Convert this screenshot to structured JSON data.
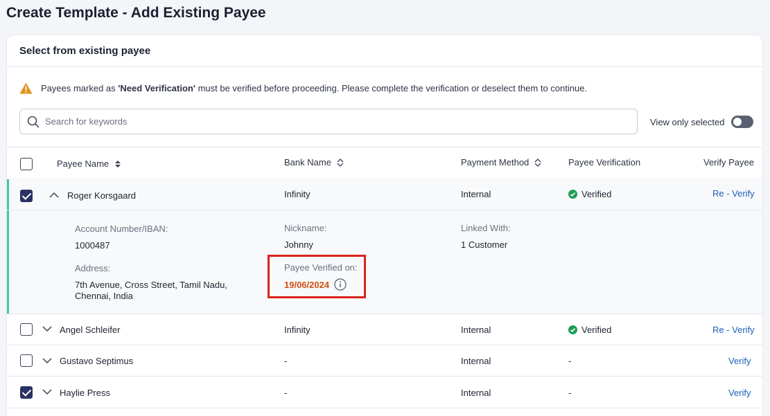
{
  "page": {
    "title": "Create Template - Add Existing Payee"
  },
  "card": {
    "title": "Select from existing payee"
  },
  "warning": {
    "prefix": "Payees marked as ",
    "highlight": "'Need Verification'",
    "suffix": " must be verified before proceeding. Please complete the verification or deselect them to continue."
  },
  "search": {
    "placeholder": "Search for keywords"
  },
  "toggle": {
    "label": "View only selected",
    "on": false
  },
  "table": {
    "headers": {
      "payee_name": "Payee Name",
      "bank_name": "Bank Name",
      "payment_method": "Payment Method",
      "payee_verification": "Payee Verification",
      "verify_payee": "Verify Payee"
    },
    "rows": [
      {
        "name": "Roger Korsgaard",
        "bank": "Infinity",
        "method": "Internal",
        "verification": "Verified",
        "action": "Re - Verify",
        "checked": true,
        "expanded": true
      },
      {
        "name": "Angel Schleifer",
        "bank": "Infinity",
        "method": "Internal",
        "verification": "Verified",
        "action": "Re - Verify",
        "checked": false,
        "expanded": false
      },
      {
        "name": "Gustavo Septimus",
        "bank": "-",
        "method": "Internal",
        "verification": "-",
        "action": "Verify",
        "checked": false,
        "expanded": false
      },
      {
        "name": "Haylie Press",
        "bank": "-",
        "method": "Internal",
        "verification": "-",
        "action": "Verify",
        "checked": true,
        "expanded": false
      }
    ]
  },
  "details": {
    "account_label": "Account Number/IBAN:",
    "account_value": "1000487",
    "nickname_label": "Nickname:",
    "nickname_value": "Johnny",
    "linked_label": "Linked With:",
    "linked_value": "1 Customer",
    "address_label": "Address:",
    "address_line1": "7th Avenue, Cross Street, Tamil Nadu,",
    "address_line2": "Chennai, India",
    "verified_on_label": "Payee Verified on:",
    "verified_on_value": "19/06/2024"
  },
  "colors": {
    "accent": "#2a3263",
    "link": "#1f5fb8",
    "success": "#1f9d55",
    "warning": "#e0931f",
    "highlight_border": "#d9231b",
    "date": "#d24e14",
    "row_marker": "#3ecb9c"
  }
}
